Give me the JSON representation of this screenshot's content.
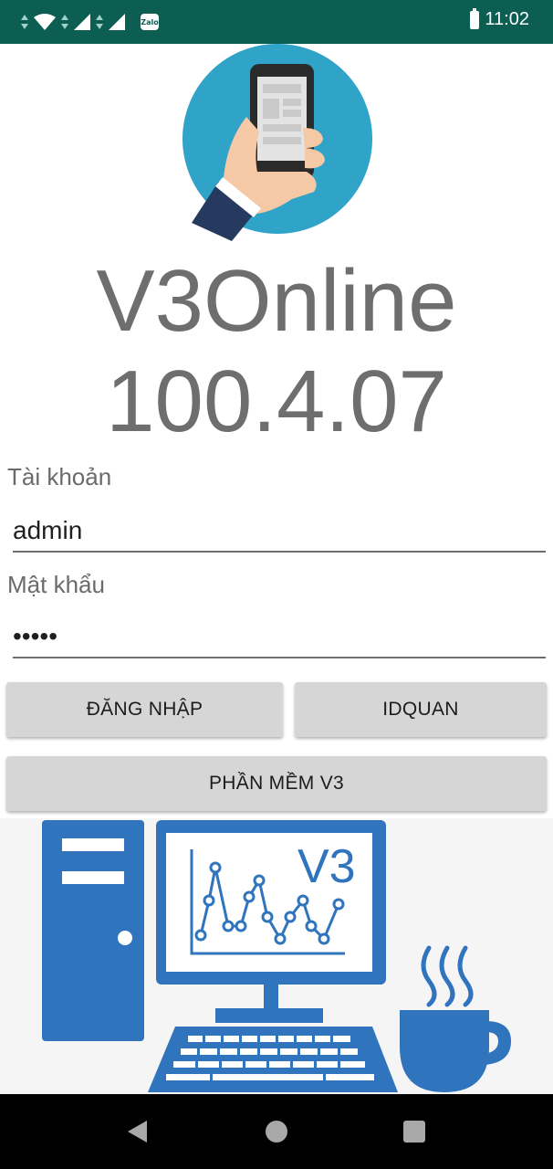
{
  "status_bar": {
    "time": "11:02",
    "zalo_label": "Zalo",
    "icons": [
      "wifi-icon",
      "signal-icon",
      "zalo-icon",
      "battery-icon"
    ],
    "background": "#0c5e52"
  },
  "app": {
    "name": "V3Online",
    "version": "100.4.07"
  },
  "form": {
    "username_label": "Tài khoản",
    "username_value": "admin",
    "password_label": "Mật khẩu",
    "password_value": "admin"
  },
  "buttons": {
    "login": "ĐĂNG NHẬP",
    "idquan": "IDQUAN",
    "software": "PHẦN MỀM V3"
  },
  "illustration": {
    "screen_label": "V3",
    "accent_color": "#2f74bd"
  },
  "nav": {
    "icons": [
      "back-icon",
      "home-icon",
      "recents-icon"
    ]
  }
}
